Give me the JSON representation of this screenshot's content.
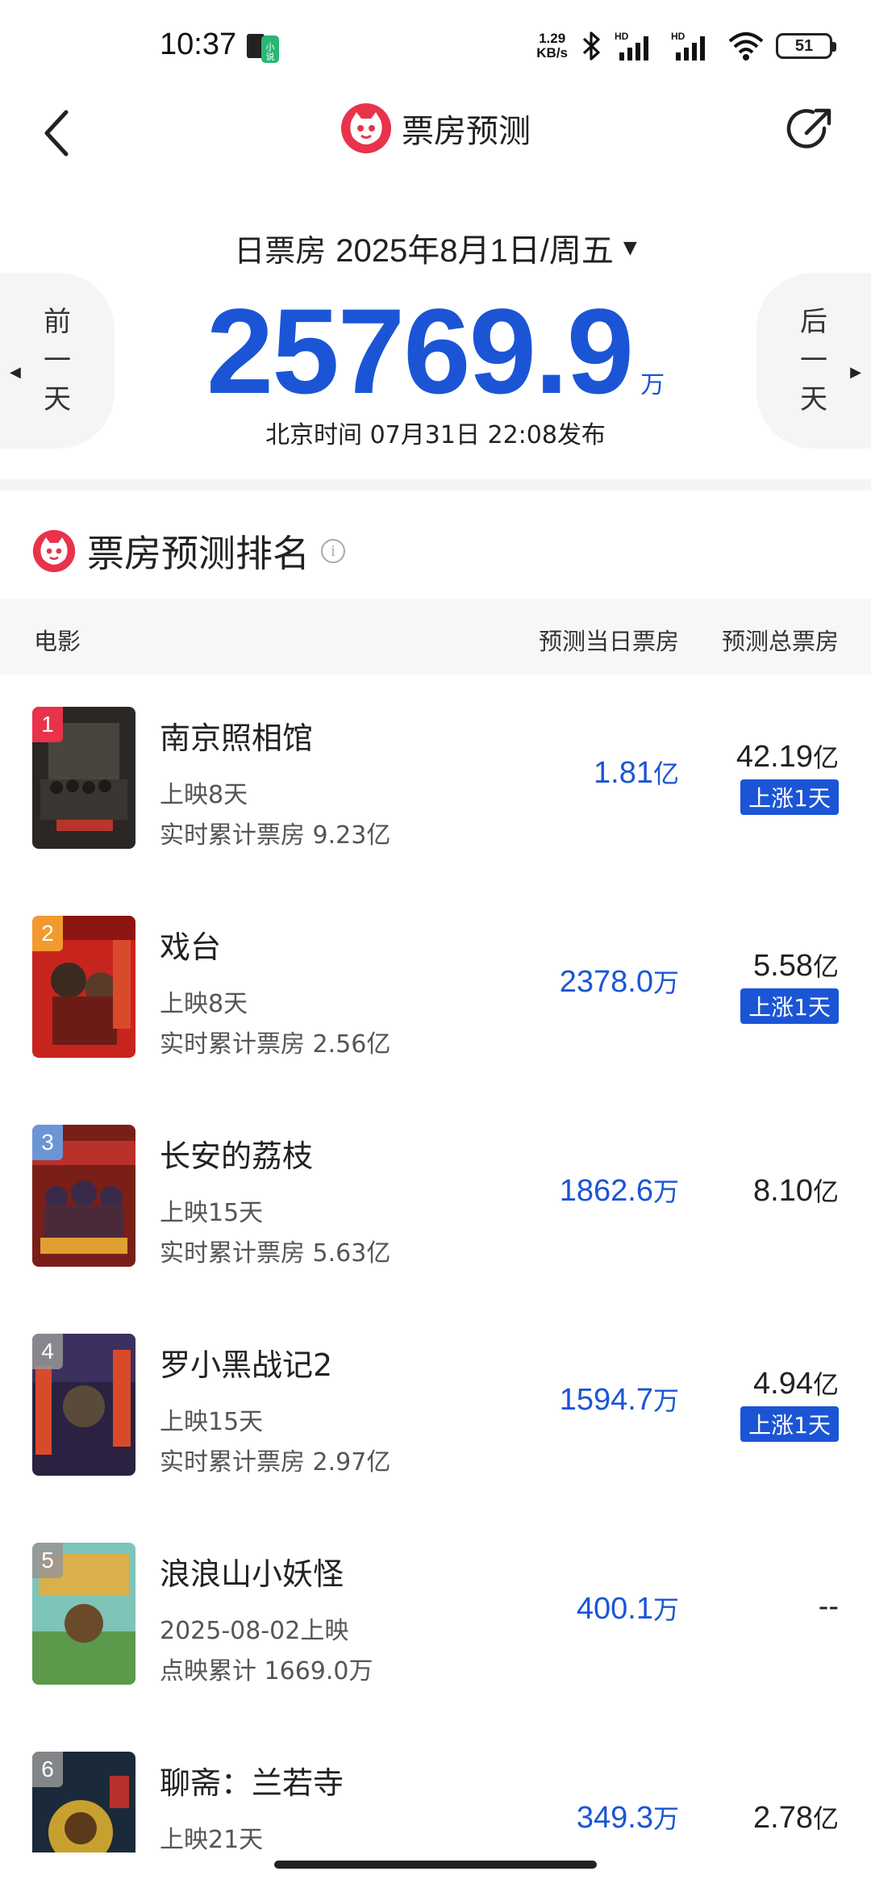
{
  "status_bar": {
    "time": "10:37",
    "net_speed_value": "1.29",
    "net_speed_unit": "KB/s",
    "signal1_label": "HD",
    "signal2_label": "HD",
    "battery": "51"
  },
  "nav": {
    "title": "票房预测",
    "back_icon": "chevron-left-icon",
    "share_icon": "share-icon"
  },
  "summary": {
    "date_label": "日票房",
    "date_value": "2025年8月1日/周五",
    "prev_label": [
      "前",
      "一",
      "天"
    ],
    "next_label": [
      "后",
      "一",
      "天"
    ],
    "box_office": "25769.9",
    "unit": "万",
    "publish_time": "北京时间  07月31日  22:08发布"
  },
  "ranking": {
    "title": "票房预测排名",
    "columns": {
      "movie": "电影",
      "day": "预测当日票房",
      "total": "预测总票房"
    },
    "rise_label": "上涨1天",
    "movies": [
      {
        "rank": "1",
        "name": "南京照相馆",
        "sub1": "上映8天",
        "sub2": "实时累计票房 9.23亿",
        "day_value": "1.81",
        "day_unit": "亿",
        "total_value": "42.19",
        "total_unit": "亿",
        "rise": true
      },
      {
        "rank": "2",
        "name": "戏台",
        "sub1": "上映8天",
        "sub2": "实时累计票房 2.56亿",
        "day_value": "2378.0",
        "day_unit": "万",
        "total_value": "5.58",
        "total_unit": "亿",
        "rise": true
      },
      {
        "rank": "3",
        "name": "长安的荔枝",
        "sub1": "上映15天",
        "sub2": "实时累计票房 5.63亿",
        "day_value": "1862.6",
        "day_unit": "万",
        "total_value": "8.10",
        "total_unit": "亿",
        "rise": false
      },
      {
        "rank": "4",
        "name": "罗小黑战记2",
        "sub1": "上映15天",
        "sub2": "实时累计票房 2.97亿",
        "day_value": "1594.7",
        "day_unit": "万",
        "total_value": "4.94",
        "total_unit": "亿",
        "rise": true
      },
      {
        "rank": "5",
        "name": "浪浪山小妖怪",
        "sub1": "2025-08-02上映",
        "sub2": "点映累计 1669.0万",
        "day_value": "400.1",
        "day_unit": "万",
        "total_value": "--",
        "total_unit": "",
        "rise": false
      },
      {
        "rank": "6",
        "name": "聊斋：兰若寺",
        "sub1": "上映21天",
        "sub2": "",
        "day_value": "349.3",
        "day_unit": "万",
        "total_value": "2.78",
        "total_unit": "亿",
        "rise": false
      }
    ]
  },
  "colors": {
    "accent": "#1b55d6",
    "brand_red": "#e8334a"
  }
}
